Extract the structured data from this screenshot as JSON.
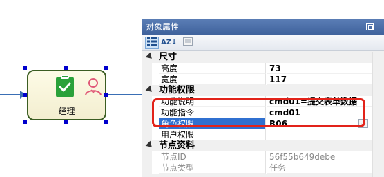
{
  "node": {
    "label": "经理",
    "icons": [
      "task-check-icon",
      "user-role-icon"
    ],
    "border_color": "#3b5d22"
  },
  "panel": {
    "title": "对象属性",
    "title_bar_color": "#4a6fa8",
    "toolbar": {
      "categorized_icon": "categorized-view-icon",
      "sort_az_label": "AZ↓",
      "property_pages_icon": "property-pages-icon"
    },
    "categories": [
      {
        "label": "尺寸",
        "rows": [
          {
            "name": "高度",
            "value": "73"
          },
          {
            "name": "宽度",
            "value": "117"
          }
        ]
      },
      {
        "label": "功能权限",
        "rows": [
          {
            "name": "功能说明",
            "value": "cmd01=提交表单数据"
          },
          {
            "name": "功能指令",
            "value": "cmd01"
          },
          {
            "name": "角色权限",
            "value": "R06",
            "ellipsis": "..."
          },
          {
            "name": "用户权限",
            "value": ""
          }
        ]
      },
      {
        "label": "节点资料",
        "rows": [
          {
            "name": "节点ID",
            "value": "56f55b649debe"
          },
          {
            "name": "节点类型",
            "value": "任务"
          }
        ]
      }
    ],
    "selected_row_color": "#3070d0",
    "highlight_color": "#e2231a"
  }
}
